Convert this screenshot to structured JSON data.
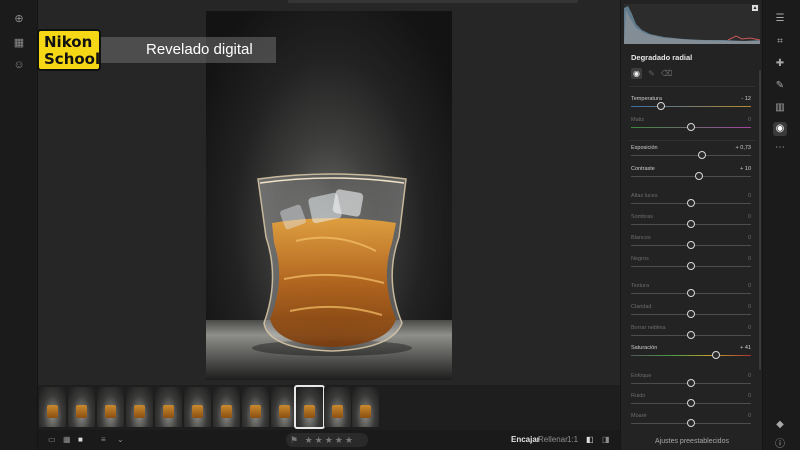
{
  "overlay": {
    "logo_line1": "Nikon",
    "logo_line2": "School",
    "title": "Revelado digital"
  },
  "colors": {
    "logo_bg": "#f6d716",
    "panel_bg": "#232323",
    "canvas_bg": "#262626"
  },
  "left_rail": {
    "icons": [
      "add-icon",
      "library-icon",
      "people-icon"
    ]
  },
  "filmstrip": {
    "thumb_count": 12,
    "selected_index": 9
  },
  "bottom_bar": {
    "view_icons": [
      "single-view-icon",
      "grid-view-icon",
      "detail-view-icon",
      "sort-icon",
      "chevron-down-icon"
    ],
    "stars": "★★★★★",
    "fit": "Encajar",
    "fill": "Rellenar",
    "one_to_one": "1:1"
  },
  "panel": {
    "title": "Degradado radial",
    "footer": "Ajustes preestablecidos",
    "sliders": [
      {
        "label": "Temperatura",
        "value": "- 12",
        "pos": 0.25,
        "active": true
      },
      {
        "label": "Matiz",
        "value": "0",
        "pos": 0.5,
        "active": false
      },
      {
        "label": "Exposición",
        "value": "+ 0,73",
        "pos": 0.59,
        "active": true
      },
      {
        "label": "Contraste",
        "value": "+ 10",
        "pos": 0.57,
        "active": true
      },
      {
        "label": "Altas luces",
        "value": "0",
        "pos": 0.5,
        "active": false
      },
      {
        "label": "Sombras",
        "value": "0",
        "pos": 0.5,
        "active": false
      },
      {
        "label": "Blancos",
        "value": "0",
        "pos": 0.5,
        "active": false
      },
      {
        "label": "Negros",
        "value": "0",
        "pos": 0.5,
        "active": false
      },
      {
        "label": "Textura",
        "value": "0",
        "pos": 0.5,
        "active": false
      },
      {
        "label": "Claridad",
        "value": "0",
        "pos": 0.5,
        "active": false
      },
      {
        "label": "Borrar neblina",
        "value": "0",
        "pos": 0.5,
        "active": false
      },
      {
        "label": "Saturación",
        "value": "+ 41",
        "pos": 0.71,
        "active": true
      },
      {
        "label": "Enfoque",
        "value": "0",
        "pos": 0.5,
        "active": false
      },
      {
        "label": "Ruido",
        "value": "0",
        "pos": 0.5,
        "active": false
      },
      {
        "label": "Moaré",
        "value": "0",
        "pos": 0.5,
        "active": false
      }
    ]
  },
  "tools": [
    "edit-icon",
    "crop-icon",
    "healing-icon",
    "brush-icon",
    "linear-gradient-icon",
    "radial-gradient-icon",
    "more-icon",
    "tag-icon",
    "info-icon"
  ]
}
